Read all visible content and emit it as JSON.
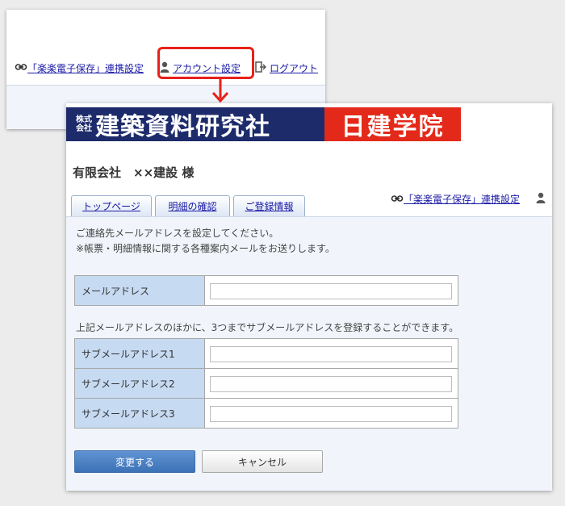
{
  "back_nav": {
    "link_label": "「楽楽電子保存」連携設定",
    "account_label": "アカウント設定",
    "logout_label": "ログアウト"
  },
  "logo": {
    "kabu_top": "株式",
    "kabu_bottom": "会社",
    "company": "建築資料研究社",
    "school": "日建学院"
  },
  "customer": {
    "name": "有限会社　××建設 様"
  },
  "tabs": [
    {
      "label": "トップページ"
    },
    {
      "label": "明細の確認"
    },
    {
      "label": "ご登録情報"
    }
  ],
  "right_nav": {
    "link_label": "「楽楽電子保存」連携設定"
  },
  "intro": {
    "line1": "ご連絡先メールアドレスを設定してください。",
    "line2": "※帳票・明細情報に関する各種案内メールをお送りします。"
  },
  "main_field": {
    "label": "メールアドレス",
    "value": ""
  },
  "sub_note": "上記メールアドレスのほかに、3つまでサブメールアドレスを登録することができます。",
  "sub_fields": [
    {
      "label": "サブメールアドレス1",
      "value": ""
    },
    {
      "label": "サブメールアドレス2",
      "value": ""
    },
    {
      "label": "サブメールアドレス3",
      "value": ""
    }
  ],
  "buttons": {
    "submit": "変更する",
    "cancel": "キャンセル"
  },
  "colors": {
    "highlight": "#e8211a",
    "logo_navy": "#1d2b6b",
    "logo_red": "#e32a1a",
    "label_bg": "#c6daf2",
    "primary_button": "#4a80c4"
  },
  "icons": {
    "link": "link-icon",
    "account": "user-icon",
    "logout": "logout-icon",
    "pointer": "arrow-down-icon"
  }
}
